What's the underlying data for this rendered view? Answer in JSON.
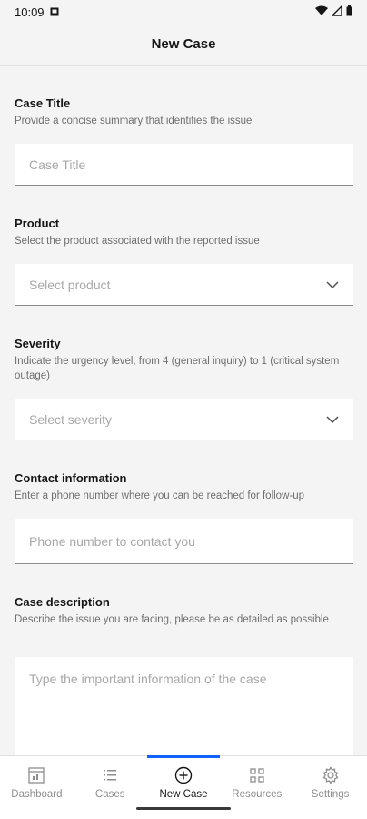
{
  "status": {
    "time": "10:09"
  },
  "header": {
    "title": "New Case"
  },
  "form": {
    "case_title": {
      "label": "Case Title",
      "help": "Provide a concise summary that identifies the issue",
      "placeholder": "Case Title"
    },
    "product": {
      "label": "Product",
      "help": "Select the product associated with the reported issue",
      "placeholder": "Select product"
    },
    "severity": {
      "label": "Severity",
      "help": "Indicate the urgency level, from 4 (general inquiry) to 1 (critical system outage)",
      "placeholder": "Select severity"
    },
    "contact": {
      "label": "Contact information",
      "help": "Enter a phone number where you can be reached for follow-up",
      "placeholder": "Phone number to contact you"
    },
    "description": {
      "label": "Case description",
      "help": "Describe the issue you are facing, please be as detailed as possible",
      "placeholder": "Type the important information of the case"
    }
  },
  "tabs": [
    {
      "label": "Dashboard",
      "icon": "dashboard-icon"
    },
    {
      "label": "Cases",
      "icon": "list-icon"
    },
    {
      "label": "New Case",
      "icon": "add-circle-icon",
      "active": true
    },
    {
      "label": "Resources",
      "icon": "grid-icon"
    },
    {
      "label": "Settings",
      "icon": "gear-icon"
    }
  ],
  "colors": {
    "accent": "#0f62fe",
    "background": "#f4f4f4",
    "field": "#ffffff",
    "placeholder": "#a8a8a8",
    "helper": "#6f6f6f"
  }
}
